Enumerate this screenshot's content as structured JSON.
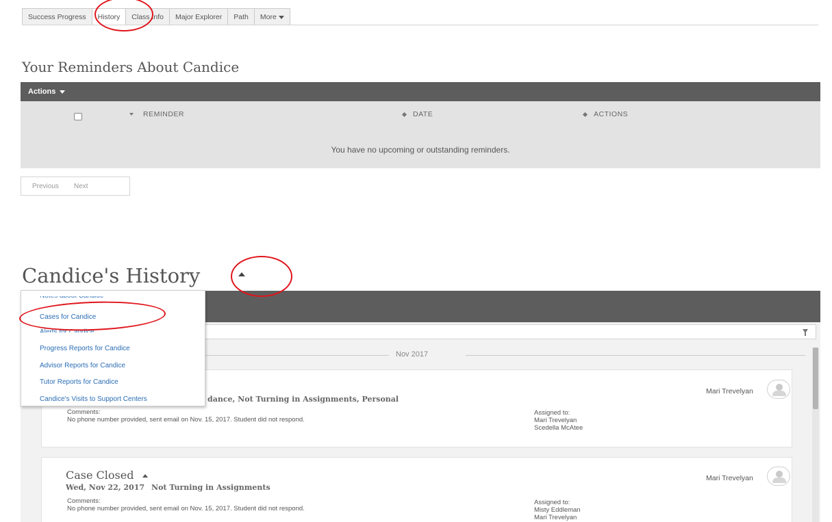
{
  "tabs": [
    {
      "label": "Success Progress"
    },
    {
      "label": "History"
    },
    {
      "label": "Class Info"
    },
    {
      "label": "Major Explorer"
    },
    {
      "label": "Path"
    },
    {
      "label": "More"
    }
  ],
  "reminders": {
    "title": "Your Reminders About Candice",
    "actions_label": "Actions",
    "columns": [
      "REMINDER",
      "DATE",
      "ACTIONS"
    ],
    "empty_message": "You have no upcoming or outstanding reminders.",
    "pager": {
      "previous": "Previous",
      "next": "Next"
    }
  },
  "history": {
    "title": "Candice's History",
    "dropdown": [
      "Notes about Candice",
      "Cases for Candice",
      "Alerts for Candice",
      "Progress Reports for Candice",
      "Advisor Reports for Candice",
      "Tutor Reports for Candice",
      "Candice's Visits to Support Centers"
    ],
    "date_separator": "Nov 2017",
    "cases": [
      {
        "subtitle_visible": "dance, Not Turning in Assignments, Personal",
        "comments_label": "Comments:",
        "comment": "No phone number provided, sent email on Nov. 15, 2017. Student did not respond.",
        "assigned_label": "Assigned to:",
        "assigned": [
          "Mari Trevelyan",
          "Scedella McAtee"
        ],
        "owner": "Mari Trevelyan"
      },
      {
        "title": "Case Closed",
        "date": "Wed, Nov 22, 2017",
        "reasons": "Not Turning in Assignments",
        "comments_label": "Comments:",
        "comment": "No phone number provided, sent email on Nov. 15, 2017. Student did not respond.",
        "assigned_label": "Assigned to:",
        "assigned": [
          "Misty Eddleman",
          "Mari Trevelyan"
        ],
        "owner": "Mari Trevelyan"
      }
    ]
  },
  "colors": {
    "header_bar": "#5d5d5d",
    "link": "#2a6cb4",
    "annotation": "#e0141b"
  }
}
